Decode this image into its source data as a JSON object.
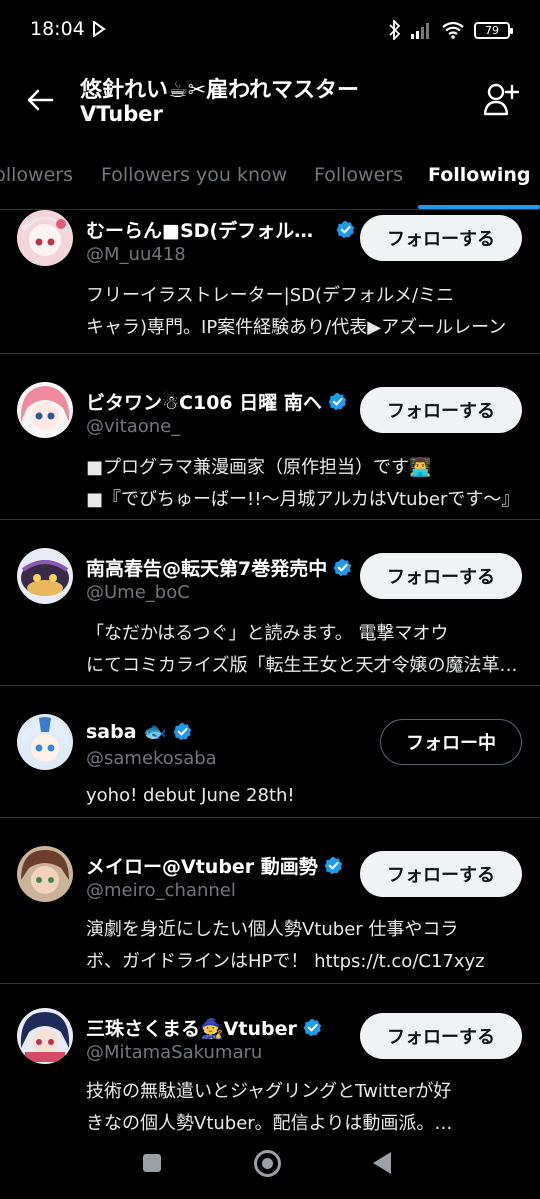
{
  "status_bar": {
    "time": "18:04",
    "battery": "79"
  },
  "header": {
    "title": "悠針れい☕✂雇われマスター",
    "subtitle": "VTuber"
  },
  "tabs": [
    {
      "label": "Followers"
    },
    {
      "label": "Followers you know"
    },
    {
      "label": "Followers"
    },
    {
      "label": "Following"
    }
  ],
  "users": [
    {
      "name": "むーらん■SD(デフォルメ/ミニキャラ)",
      "handle": "@M_uu418",
      "verified": true,
      "button": "フォローする",
      "bio": [
        "フリーイラストレーター|SD(デフォルメ/ミニ",
        "キャラ)専門。IP案件経験あり/代表▶アズールレーン"
      ],
      "avatar_color": "#f2d6dc"
    },
    {
      "name": "ビタワン☃C106 日曜 南ヘ",
      "handle": "@vitaone_",
      "verified": true,
      "button": "フォローする",
      "bio": [
        "■プログラマ兼漫画家（原作担当）です👨‍💻",
        "■『でびちゅーばー!!〜月城アルカはVtuberです〜』"
      ],
      "avatar_color": "#f4b8c4"
    },
    {
      "name": "南高春告@転天第7巻発売中",
      "handle": "@Ume_boC",
      "verified": true,
      "button": "フォローする",
      "bio": [
        "「なだかはるつぐ」と読みます。 電撃マオウ",
        "にてコミカライズ版「転生王女と天才令嬢の魔法革命」"
      ],
      "avatar_color": "#5a3d6b"
    },
    {
      "name": "saba 🐟",
      "handle": "@samekosaba",
      "verified": true,
      "button": "フォロー中",
      "bio": [
        "yoho! debut June 28th!"
      ],
      "avatar_color": "#cfe3f2"
    },
    {
      "name": "メイロー@Vtuber 動画勢",
      "handle": "@meiro_channel",
      "verified": true,
      "button": "フォローする",
      "bio": [
        "演劇を身近にしたい個人勢Vtuber 仕事やコラ",
        "ボ、ガイドラインはHPで！ https://t.co/C17xyz"
      ],
      "avatar_color": "#7a5040"
    },
    {
      "name": "三珠さくまる🧙Vtuber",
      "handle": "@MitamaSakumaru",
      "verified": true,
      "button": "フォローする",
      "bio": [
        "技術の無駄遣いとジャグリングとTwitterが好",
        "きなの個人勢Vtuber。配信よりは動画派。…"
      ],
      "avatar_color": "#2a3f78"
    }
  ],
  "colors": {
    "accent": "#1d9bf0",
    "background": "#000000",
    "muted": "#71767b"
  }
}
